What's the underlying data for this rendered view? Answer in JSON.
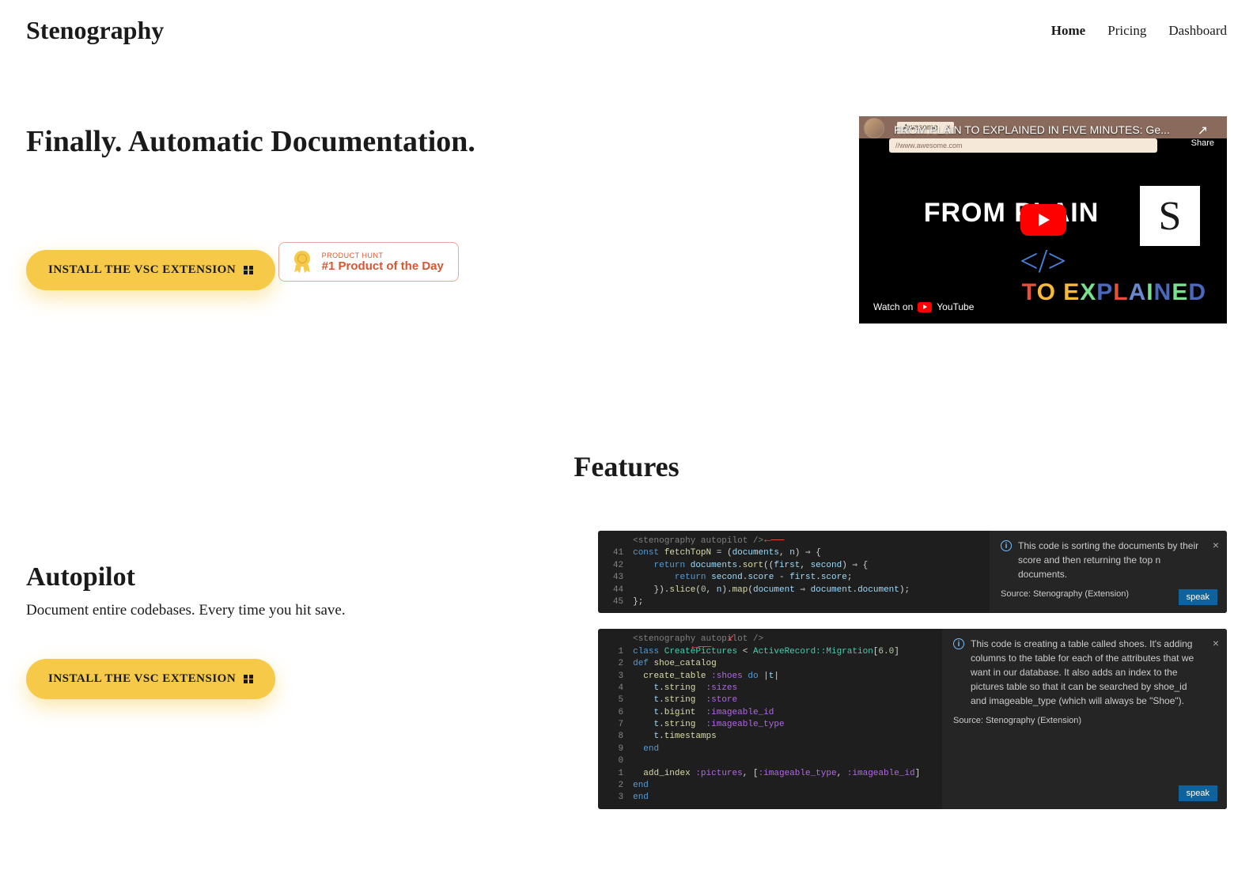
{
  "brand": "Stenography",
  "nav": {
    "items": [
      {
        "label": "Home",
        "active": true
      },
      {
        "label": "Pricing",
        "active": false
      },
      {
        "label": "Dashboard",
        "active": false
      }
    ]
  },
  "hero": {
    "title": "Finally. Automatic Documentation.",
    "install_button": "INSTALL THE VSC EXTENSION",
    "product_hunt": {
      "label": "PRODUCT HUNT",
      "title": "#1 Product of the Day"
    }
  },
  "video": {
    "title": "FROM PLAIN TO EXPLAINED IN FIVE MINUTES: Ge...",
    "share": "Share",
    "tab_label": "Awesome",
    "url": "//www.awesome.com",
    "text_top": "FROM PLAIN",
    "text_to": "TO",
    "text_explained": "EXPLAINED",
    "s_logo": "S",
    "watch_label": "Watch on",
    "youtube": "YouTube"
  },
  "features": {
    "header": "Features",
    "autopilot": {
      "title": "Autopilot",
      "description": "Document entire codebases. Every time you hit save.",
      "install_button": "INSTALL THE VSC EXTENSION"
    },
    "panel1": {
      "annotation": "<stenography autopilot />",
      "lines": {
        "l41_num": "41",
        "l42_num": "42",
        "l43_num": "43",
        "l44_num": "44",
        "l45_num": "45"
      },
      "info_text": "This code is sorting the documents by their score and then returning the top n documents.",
      "source": "Source: Stenography (Extension)",
      "speak": "speak"
    },
    "panel2": {
      "annotation": "<stenography autopilot />",
      "lines": {
        "l1": "1",
        "l2": "2",
        "l3": "3",
        "l4": "4",
        "l5": "5",
        "l6": "6",
        "l7": "7",
        "l8": "8",
        "l9": "9",
        "l0a": "0",
        "l1a": "1",
        "l2a": "2",
        "l3a": "3"
      },
      "info_text": "This code is creating a table called shoes. It's adding columns to the table for each of the attributes that we want in our database. It also adds an index to the pictures table so that it can be searched by shoe_id and imageable_type (which will always be \"Shoe\").",
      "source": "Source: Stenography (Extension)",
      "speak": "speak"
    }
  }
}
